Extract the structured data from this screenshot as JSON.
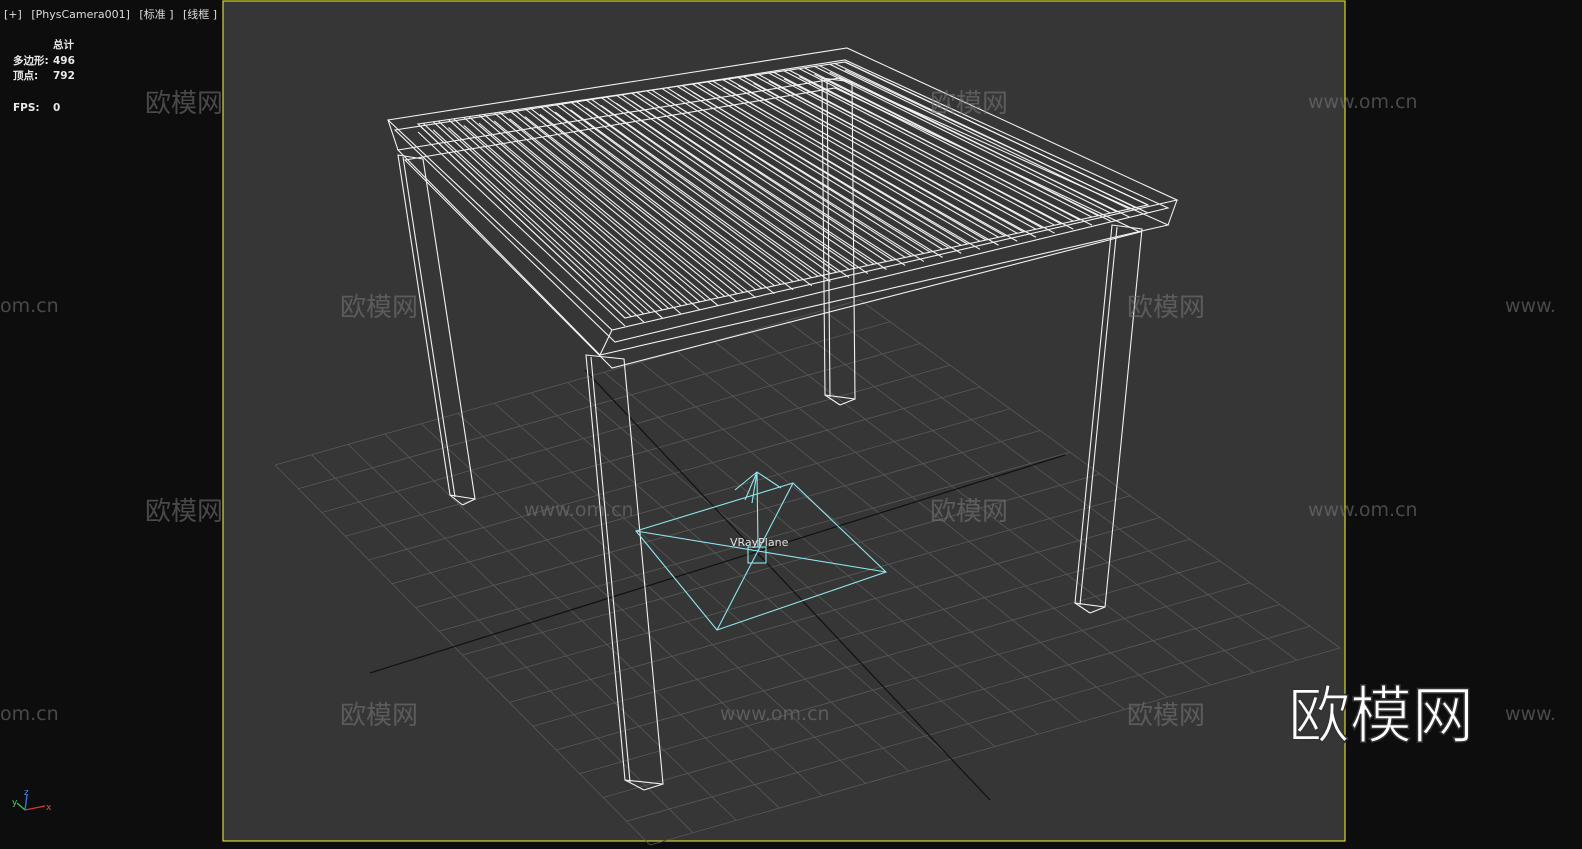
{
  "viewport": {
    "labels": [
      "[+]",
      "[PhysCamera001]",
      "[标准 ]",
      "[线框 ]"
    ],
    "stats": {
      "header": "总计",
      "polygons_label": "多边形:",
      "polygons_value": "496",
      "vertices_label": "顶点:",
      "vertices_value": "792",
      "fps_label": "FPS:",
      "fps_value": "0"
    },
    "object_label": "VRayPlane",
    "axis_tripod": {
      "z": "z",
      "y": "y",
      "x": "x"
    }
  },
  "watermarks": {
    "cn": "欧模网",
    "url": "www.om.cn",
    "url_partial": "om.cn",
    "url_prefix": "www.",
    "big_logo": "欧模网"
  },
  "colors": {
    "background": "#0d0d0d",
    "safe_frame": "#3a3a3a",
    "frame_border": "#d6d62e",
    "grid": "#5a5a5a",
    "wire": "#ffffff",
    "vray_plane": "#8ee8ee"
  }
}
